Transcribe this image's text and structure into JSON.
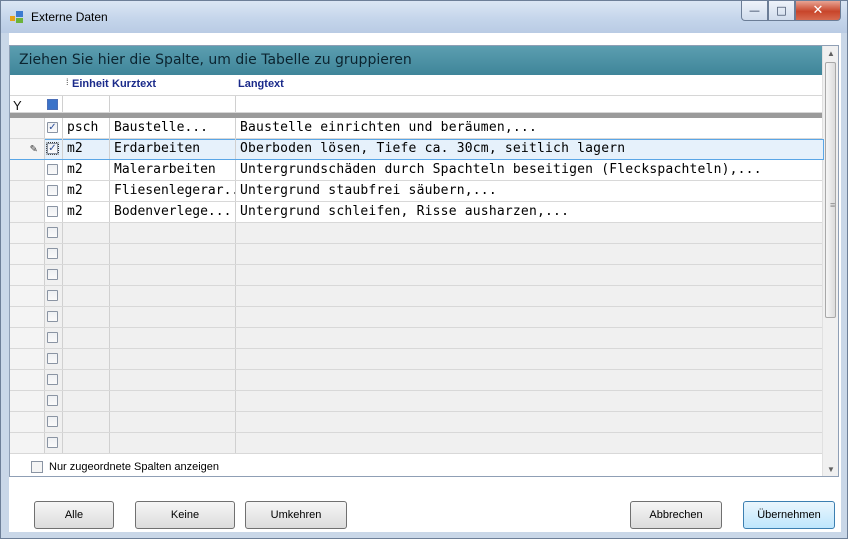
{
  "window": {
    "title": "Externe Daten",
    "min_glyph": "—",
    "max_glyph": "□",
    "close_glyph": "✕"
  },
  "grid": {
    "group_hint": "Ziehen Sie hier die Spalte, um die Tabelle zu gruppieren",
    "columns": [
      "Einheit",
      "Kurztext",
      "Langtext"
    ],
    "rows": [
      {
        "checked": true,
        "einheit": "psch",
        "kurztext": "Baustelle...",
        "langtext": "Baustelle einrichten und beräumen,..."
      },
      {
        "checked": true,
        "einheit": "m2",
        "kurztext": "Erdarbeiten",
        "langtext": "Oberboden lösen, Tiefe ca. 30cm, seitlich lagern",
        "selected": true
      },
      {
        "checked": false,
        "einheit": "m2",
        "kurztext": "Malerarbeiten",
        "langtext": "Untergrundschäden durch Spachteln beseitigen (Fleckspachteln),..."
      },
      {
        "checked": false,
        "einheit": "m2",
        "kurztext": "Fliesenlegerar...",
        "langtext": "Untergrund staubfrei säubern,..."
      },
      {
        "checked": false,
        "einheit": "m2",
        "kurztext": "Bodenverlege...",
        "langtext": "Untergrund schleifen, Risse ausharzen,..."
      }
    ],
    "empty_rows": 11,
    "check_glyph": "✓",
    "edit_glyph": "✎",
    "filter_glyph": "Y"
  },
  "footer": {
    "only_assigned_label": "Nur zugeordnete Spalten anzeigen",
    "buttons": {
      "all": "Alle",
      "none": "Keine",
      "invert": "Umkehren",
      "cancel": "Abbrechen",
      "apply": "Übernehmen"
    }
  },
  "colors": {
    "group_panel": "#4a90a4",
    "header_text": "#1a2a8a",
    "selection_border": "#5aa6e6"
  }
}
